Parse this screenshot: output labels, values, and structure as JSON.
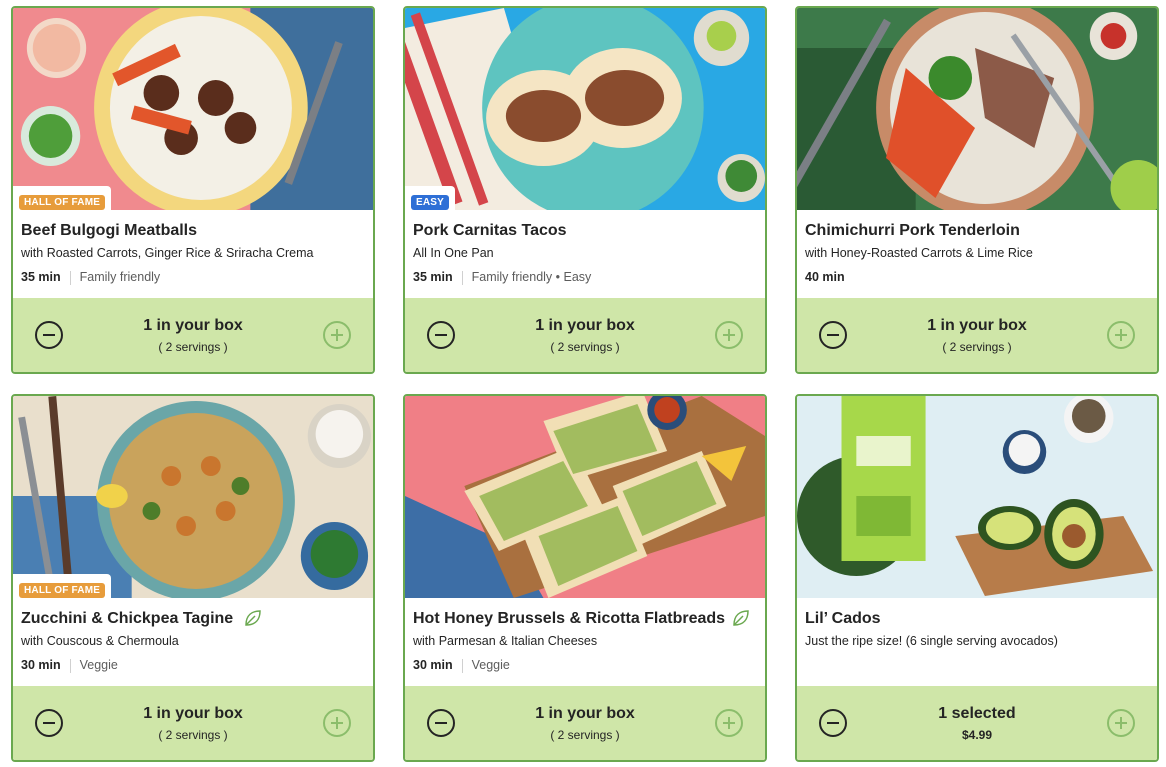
{
  "cards": [
    {
      "badge": "HALL OF FAME",
      "title": "Beef Bulgogi Meatballs",
      "subtitle": "with Roasted Carrots, Ginger Rice & Sriracha Crema",
      "time": "35 min",
      "tags": "Family friendly",
      "count": "1 in your box",
      "detail": "( 2 servings )"
    },
    {
      "badge": "EASY",
      "title": "Pork Carnitas Tacos",
      "subtitle": "All In One Pan",
      "time": "35 min",
      "tags": "Family friendly • Easy",
      "count": "1 in your box",
      "detail": "( 2 servings )"
    },
    {
      "title": "Chimichurri Pork Tenderloin",
      "subtitle": "with Honey-Roasted Carrots & Lime Rice",
      "time": "40 min",
      "count": "1 in your box",
      "detail": "( 2 servings )"
    },
    {
      "badge": "HALL OF FAME",
      "title": "Zucchini & Chickpea Tagine",
      "subtitle": "with Couscous & Chermoula",
      "time": "30 min",
      "tags": "Veggie",
      "icon": "leaf-icon",
      "count": "1 in your box",
      "detail": "( 2 servings )"
    },
    {
      "title": "Hot Honey Brussels & Ricotta Flatbreads",
      "subtitle": "with Parmesan & Italian Cheeses",
      "time": "30 min",
      "tags": "Veggie",
      "icon": "leaf-icon",
      "count": "1 in your box",
      "detail": "( 2 servings )"
    },
    {
      "title": "Lil’ Cados",
      "subtitle": "Just the ripe size! (6 single serving avocados)",
      "count": "1 selected",
      "price": "$4.99"
    }
  ],
  "colors": {
    "card_border": "#6aa84f",
    "counter_bg": "#cfe6a8",
    "badge_hof": "#e79c3b",
    "badge_easy": "#2e6fd6"
  }
}
